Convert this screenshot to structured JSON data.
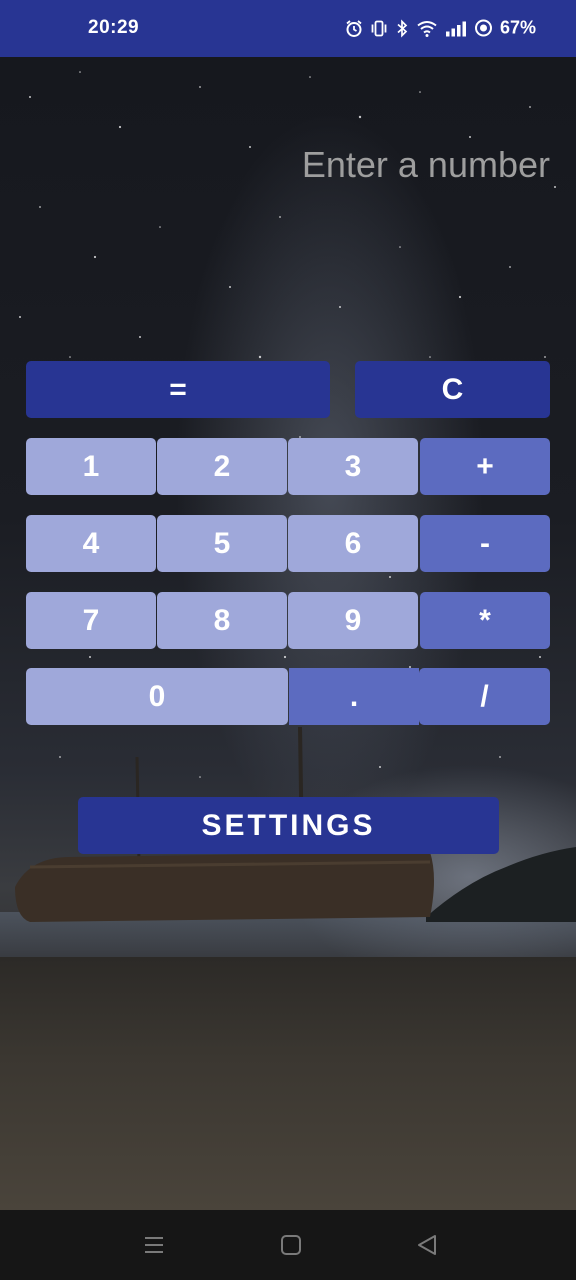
{
  "status_bar": {
    "time": "20:29",
    "battery": "67%",
    "icons": [
      "alarm-icon",
      "vibrate-icon",
      "bluetooth-icon",
      "wifi-icon",
      "signal-icon",
      "data-saver-icon"
    ]
  },
  "display": {
    "placeholder": "Enter a number"
  },
  "keypad": {
    "equals": "=",
    "clear": "C",
    "rows": [
      [
        "1",
        "2",
        "3",
        "+"
      ],
      [
        "4",
        "5",
        "6",
        "-"
      ],
      [
        "7",
        "8",
        "9",
        "*"
      ],
      [
        "0",
        ".",
        "/"
      ]
    ]
  },
  "settings_label": "SETTINGS",
  "nav": {
    "icons": [
      "recents-icon",
      "home-icon",
      "back-icon"
    ]
  },
  "colors": {
    "primary": "#283593",
    "key_light": "#9fa8da",
    "key_operator": "#5c6bc0"
  }
}
